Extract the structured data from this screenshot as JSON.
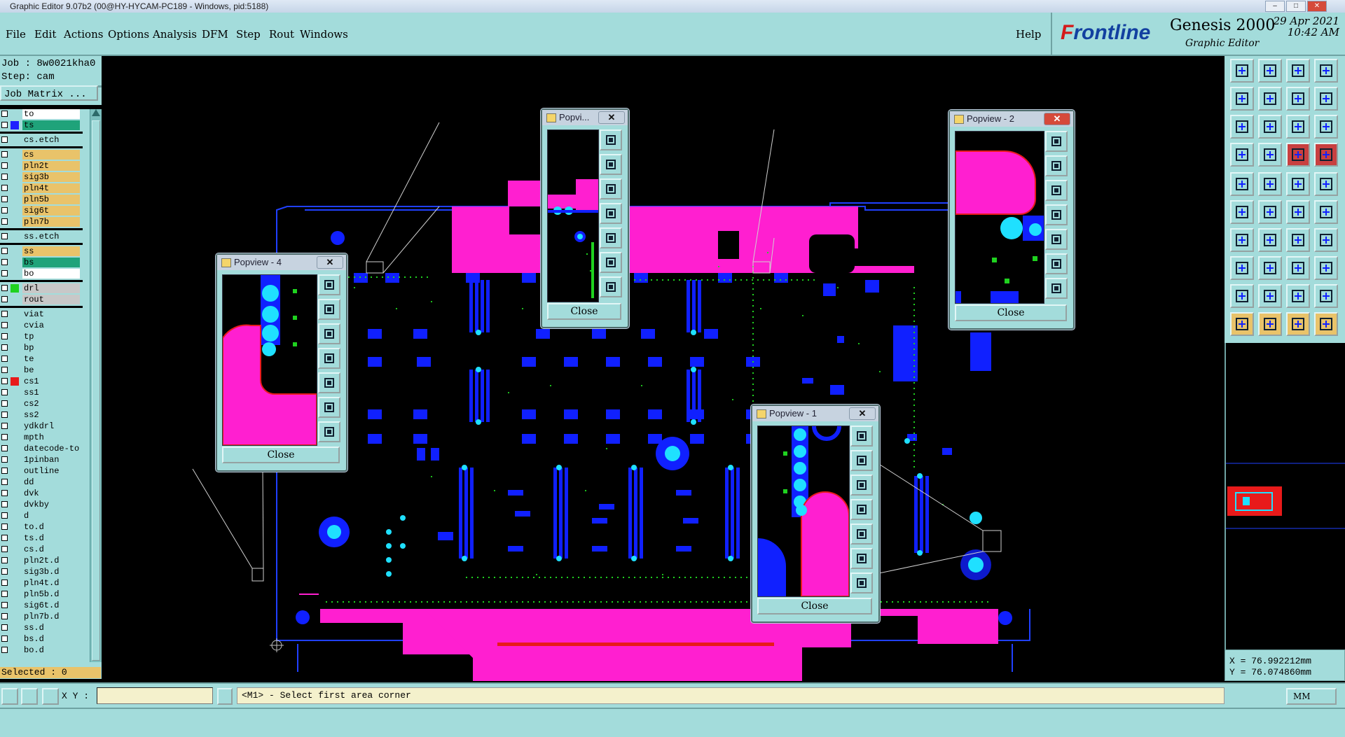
{
  "window": {
    "title": "Graphic Editor 9.07b2 (00@HY-HYCAM-PC189 - Windows, pid:5188)",
    "minimize": "–",
    "maximize": "□",
    "close": "✕"
  },
  "menu": {
    "items": [
      "File",
      "Edit",
      "Actions",
      "Options",
      "Analysis",
      "DFM",
      "Step",
      "Rout",
      "Windows"
    ],
    "help": "Help"
  },
  "brand": {
    "logo_prefix": "F",
    "logo_rest": "rontline",
    "product": "Genesis 2000",
    "subtitle": "Graphic Editor",
    "date": "29 Apr 2021",
    "time": "10:42 AM"
  },
  "job": {
    "job_label": "Job : 8w0021kha0",
    "step_label": "Step: cam",
    "job_matrix": "Job Matrix ..."
  },
  "layers": [
    {
      "name": "to",
      "color": "#ffffff",
      "swatch": "",
      "group": 0
    },
    {
      "name": "ts",
      "color": "#1fa37a",
      "swatch": "#1f1fff",
      "group": 0
    },
    {
      "name": "cs.etch",
      "color": "#a3dcdb",
      "swatch": "",
      "group": 1
    },
    {
      "name": "cs",
      "color": "#e9c36a",
      "swatch": "",
      "group": 2
    },
    {
      "name": "pln2t",
      "color": "#e9c36a",
      "swatch": "",
      "group": 2
    },
    {
      "name": "sig3b",
      "color": "#e9c36a",
      "swatch": "",
      "group": 2
    },
    {
      "name": "pln4t",
      "color": "#e9c36a",
      "swatch": "",
      "group": 2
    },
    {
      "name": "pln5b",
      "color": "#e9c36a",
      "swatch": "",
      "group": 2
    },
    {
      "name": "sig6t",
      "color": "#e9c36a",
      "swatch": "",
      "group": 2
    },
    {
      "name": "pln7b",
      "color": "#e9c36a",
      "swatch": "",
      "group": 2
    },
    {
      "name": "ss.etch",
      "color": "#a3dcdb",
      "swatch": "",
      "group": 3
    },
    {
      "name": "ss",
      "color": "#e9c36a",
      "swatch": "",
      "group": 4
    },
    {
      "name": "bs",
      "color": "#1fa37a",
      "swatch": "",
      "group": 4
    },
    {
      "name": "bo",
      "color": "#ffffff",
      "swatch": "",
      "group": 4
    },
    {
      "name": "drl",
      "color": "#c8c8c8",
      "swatch": "#1fd21f",
      "group": 5
    },
    {
      "name": "rout",
      "color": "#c8c8c8",
      "swatch": "",
      "group": 5
    },
    {
      "name": "viat",
      "color": "#a3dcdb",
      "swatch": "",
      "group": 6
    },
    {
      "name": "cvia",
      "color": "#a3dcdb",
      "swatch": "",
      "group": 6
    },
    {
      "name": "tp",
      "color": "#a3dcdb",
      "swatch": "",
      "group": 6
    },
    {
      "name": "bp",
      "color": "#a3dcdb",
      "swatch": "",
      "group": 6
    },
    {
      "name": "te",
      "color": "#a3dcdb",
      "swatch": "",
      "group": 6
    },
    {
      "name": "be",
      "color": "#a3dcdb",
      "swatch": "",
      "group": 6
    },
    {
      "name": "cs1",
      "color": "#a3dcdb",
      "swatch": "#e81a1a",
      "group": 6
    },
    {
      "name": "ss1",
      "color": "#a3dcdb",
      "swatch": "",
      "group": 6
    },
    {
      "name": "cs2",
      "color": "#a3dcdb",
      "swatch": "",
      "group": 6
    },
    {
      "name": "ss2",
      "color": "#a3dcdb",
      "swatch": "",
      "group": 6
    },
    {
      "name": "ydkdrl",
      "color": "#a3dcdb",
      "swatch": "",
      "group": 6
    },
    {
      "name": "mpth",
      "color": "#a3dcdb",
      "swatch": "",
      "group": 6
    },
    {
      "name": "datecode-to",
      "color": "#a3dcdb",
      "swatch": "",
      "group": 6
    },
    {
      "name": "1pinban",
      "color": "#a3dcdb",
      "swatch": "",
      "group": 6
    },
    {
      "name": "outline",
      "color": "#a3dcdb",
      "swatch": "",
      "group": 6
    },
    {
      "name": "dd",
      "color": "#a3dcdb",
      "swatch": "",
      "group": 6
    },
    {
      "name": "dvk",
      "color": "#a3dcdb",
      "swatch": "",
      "group": 6
    },
    {
      "name": "dvkby",
      "color": "#a3dcdb",
      "swatch": "",
      "group": 6
    },
    {
      "name": "d",
      "color": "#a3dcdb",
      "swatch": "",
      "group": 6
    },
    {
      "name": "to.d",
      "color": "#a3dcdb",
      "swatch": "",
      "group": 6
    },
    {
      "name": "ts.d",
      "color": "#a3dcdb",
      "swatch": "",
      "group": 6
    },
    {
      "name": "cs.d",
      "color": "#a3dcdb",
      "swatch": "",
      "group": 6
    },
    {
      "name": "pln2t.d",
      "color": "#a3dcdb",
      "swatch": "",
      "group": 6
    },
    {
      "name": "sig3b.d",
      "color": "#a3dcdb",
      "swatch": "",
      "group": 6
    },
    {
      "name": "pln4t.d",
      "color": "#a3dcdb",
      "swatch": "",
      "group": 6
    },
    {
      "name": "pln5b.d",
      "color": "#a3dcdb",
      "swatch": "",
      "group": 6
    },
    {
      "name": "sig6t.d",
      "color": "#a3dcdb",
      "swatch": "",
      "group": 6
    },
    {
      "name": "pln7b.d",
      "color": "#a3dcdb",
      "swatch": "",
      "group": 6
    },
    {
      "name": "ss.d",
      "color": "#a3dcdb",
      "swatch": "",
      "group": 6
    },
    {
      "name": "bs.d",
      "color": "#a3dcdb",
      "swatch": "",
      "group": 6
    },
    {
      "name": "bo.d",
      "color": "#a3dcdb",
      "swatch": "",
      "group": 6
    }
  ],
  "status": {
    "selected": "Selected : 0",
    "xy_label": "X Y :",
    "prompt": "<M1> - Select first area corner",
    "unit": "MM",
    "coord_x": "X = 76.992212mm",
    "coord_y": "Y = 76.074860mm"
  },
  "popviews": [
    {
      "title": "Popvi...",
      "close_label": "Close"
    },
    {
      "title": "Popview - 2",
      "close_label": "Close"
    },
    {
      "title": "Popview - 4",
      "close_label": "Close"
    },
    {
      "title": "Popview - 1",
      "close_label": "Close"
    }
  ],
  "popview_close_glyph": "✕",
  "colors": {
    "panel": "#a3dcdb",
    "copper": "#ff1fd0",
    "pad": "#1020ff",
    "via": "#1fe0ff",
    "drill": "#1fd21f",
    "outline": "#2040ff",
    "highlight": "#e9c36a"
  }
}
